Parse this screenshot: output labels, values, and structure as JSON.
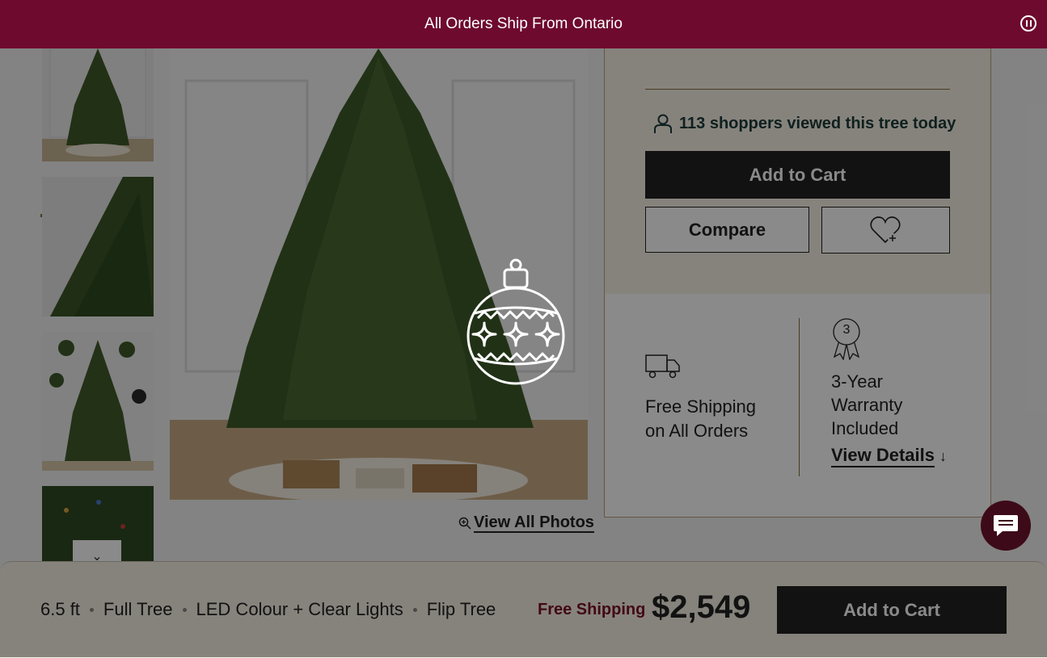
{
  "banner": {
    "text": "All Orders Ship From Ontario"
  },
  "gallery": {
    "view_all_label": "View All Photos"
  },
  "panel": {
    "viewers_count": "113",
    "viewers_text": "shoppers viewed this tree today",
    "add_to_cart_label": "Add to Cart",
    "compare_label": "Compare",
    "shipping_line1": "Free Shipping",
    "shipping_line2": "on All Orders",
    "warranty_badge_number": "3",
    "warranty_line1": "3-Year",
    "warranty_line2": "Warranty",
    "warranty_line3": "Included",
    "view_details_label": "View Details"
  },
  "sticky_bar": {
    "specs": [
      "6.5 ft",
      "Full Tree",
      "LED Colour + Clear Lights",
      "Flip Tree"
    ],
    "free_shipping": "Free Shipping",
    "price": "$2,549",
    "add_to_cart_label": "Add to Cart"
  },
  "colors": {
    "brand": "#6e0a2e",
    "accent_gold": "#8a6d3b",
    "button_dark": "#222222",
    "chat_bubble": "#3d0a19"
  }
}
